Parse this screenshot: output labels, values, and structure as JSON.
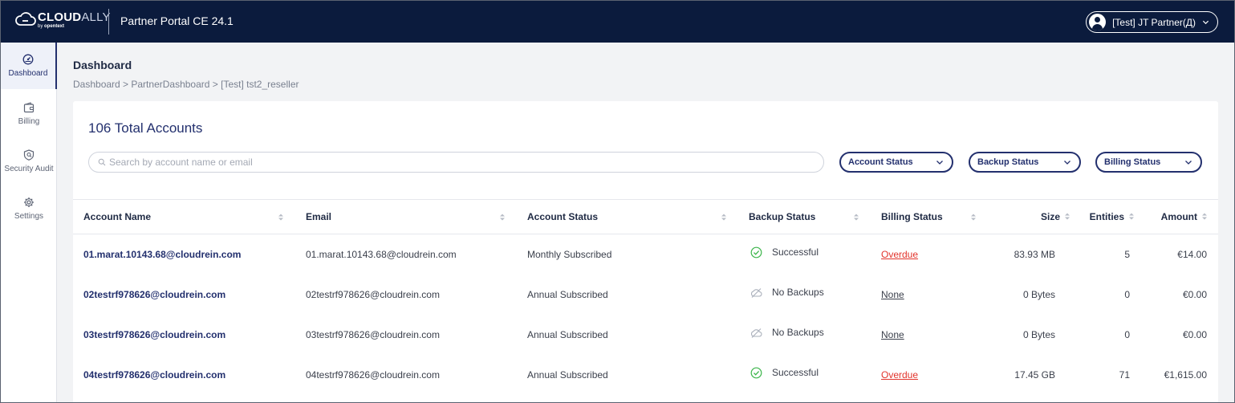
{
  "header": {
    "logo_bold": "CLOUD",
    "logo_light": "ALLY",
    "logo_by": "by",
    "logo_brand": "opentext",
    "app_title": "Partner Portal CE 24.1",
    "user_name": "[Test] JT Partner(Д)"
  },
  "sidebar": {
    "items": [
      {
        "label": "Dashboard",
        "icon": "dashboard-gauge-icon",
        "active": true
      },
      {
        "label": "Billing",
        "icon": "wallet-icon",
        "active": false
      },
      {
        "label": "Security Audit",
        "icon": "shield-icon",
        "active": false
      },
      {
        "label": "Settings",
        "icon": "gear-icon",
        "active": false
      }
    ]
  },
  "page": {
    "title": "Dashboard",
    "breadcrumb": "Dashboard > PartnerDashboard > [Test] tst2_reseller"
  },
  "summary": {
    "total_accounts": "106 Total Accounts"
  },
  "search": {
    "placeholder": "Search by account name or email",
    "value": ""
  },
  "filters": {
    "account_status": "Account Status",
    "backup_status": "Backup Status",
    "billing_status": "Billing Status"
  },
  "table": {
    "columns": {
      "account_name": "Account Name",
      "email": "Email",
      "account_status": "Account Status",
      "backup_status": "Backup Status",
      "billing_status": "Billing Status",
      "size": "Size",
      "entities": "Entities",
      "amount": "Amount"
    },
    "rows": [
      {
        "account_name": "01.marat.10143.68@cloudrein.com",
        "email": "01.marat.10143.68@cloudrein.com",
        "account_status": "Monthly Subscribed",
        "backup_status": "Successful",
        "backup_icon": "check-circle-icon",
        "billing_status": "Overdue",
        "size": "83.93 MB",
        "entities": "5",
        "amount": "€14.00"
      },
      {
        "account_name": "02testrf978626@cloudrein.com",
        "email": "02testrf978626@cloudrein.com",
        "account_status": "Annual Subscribed",
        "backup_status": "No Backups",
        "backup_icon": "cloud-off-icon",
        "billing_status": "None",
        "size": "0 Bytes",
        "entities": "0",
        "amount": "€0.00"
      },
      {
        "account_name": "03testrf978626@cloudrein.com",
        "email": "03testrf978626@cloudrein.com",
        "account_status": "Annual Subscribed",
        "backup_status": "No Backups",
        "backup_icon": "cloud-off-icon",
        "billing_status": "None",
        "size": "0 Bytes",
        "entities": "0",
        "amount": "€0.00"
      },
      {
        "account_name": "04testrf978626@cloudrein.com",
        "email": "04testrf978626@cloudrein.com",
        "account_status": "Annual Subscribed",
        "backup_status": "Successful",
        "backup_icon": "check-circle-icon",
        "billing_status": "Overdue",
        "size": "17.45 GB",
        "entities": "71",
        "amount": "€1,615.00"
      }
    ]
  },
  "colors": {
    "header_bg": "#0b1b3d",
    "brand": "#23306e",
    "success": "#3bb54a",
    "overdue": "#e2342c"
  }
}
